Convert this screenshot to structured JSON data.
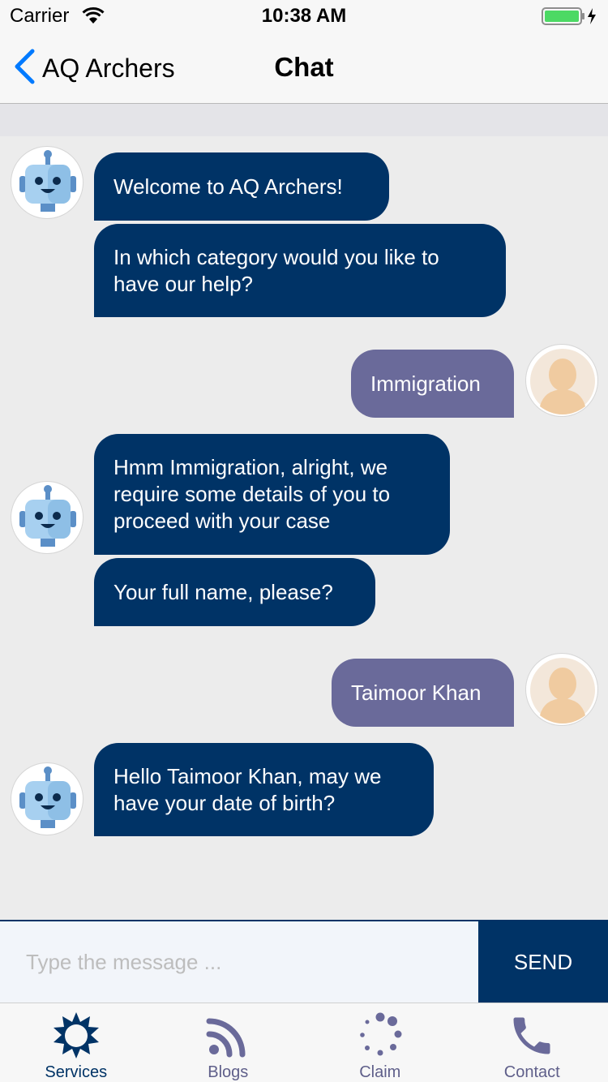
{
  "status_bar": {
    "carrier": "Carrier",
    "time": "10:38 AM"
  },
  "nav": {
    "back_label": "AQ Archers",
    "title": "Chat"
  },
  "messages": [
    {
      "sender": "bot",
      "text": "Welcome to AQ Archers!"
    },
    {
      "sender": "bot",
      "text": "In which category would you like to have our help?"
    },
    {
      "sender": "user",
      "text": "Immigration"
    },
    {
      "sender": "bot",
      "text": "Hmm Immigration, alright, we require some details of you to proceed with your case"
    },
    {
      "sender": "bot",
      "text": "Your full name, please?"
    },
    {
      "sender": "user",
      "text": "Taimoor Khan"
    },
    {
      "sender": "bot",
      "text": "Hello Taimoor Khan, may we have your date of birth?"
    }
  ],
  "input": {
    "placeholder": "Type the message ...",
    "value": "",
    "send_label": "SEND"
  },
  "tabs": [
    {
      "label": "Services",
      "icon": "sun-icon",
      "active": true
    },
    {
      "label": "Blogs",
      "icon": "rss-icon",
      "active": false
    },
    {
      "label": "Claim",
      "icon": "loading-dots-icon",
      "active": false
    },
    {
      "label": "Contact",
      "icon": "phone-icon",
      "active": false
    }
  ],
  "colors": {
    "accent": "#003366",
    "user_bubble": "#6a6a9a",
    "ios_blue": "#007aff",
    "battery_green": "#4cd964"
  }
}
